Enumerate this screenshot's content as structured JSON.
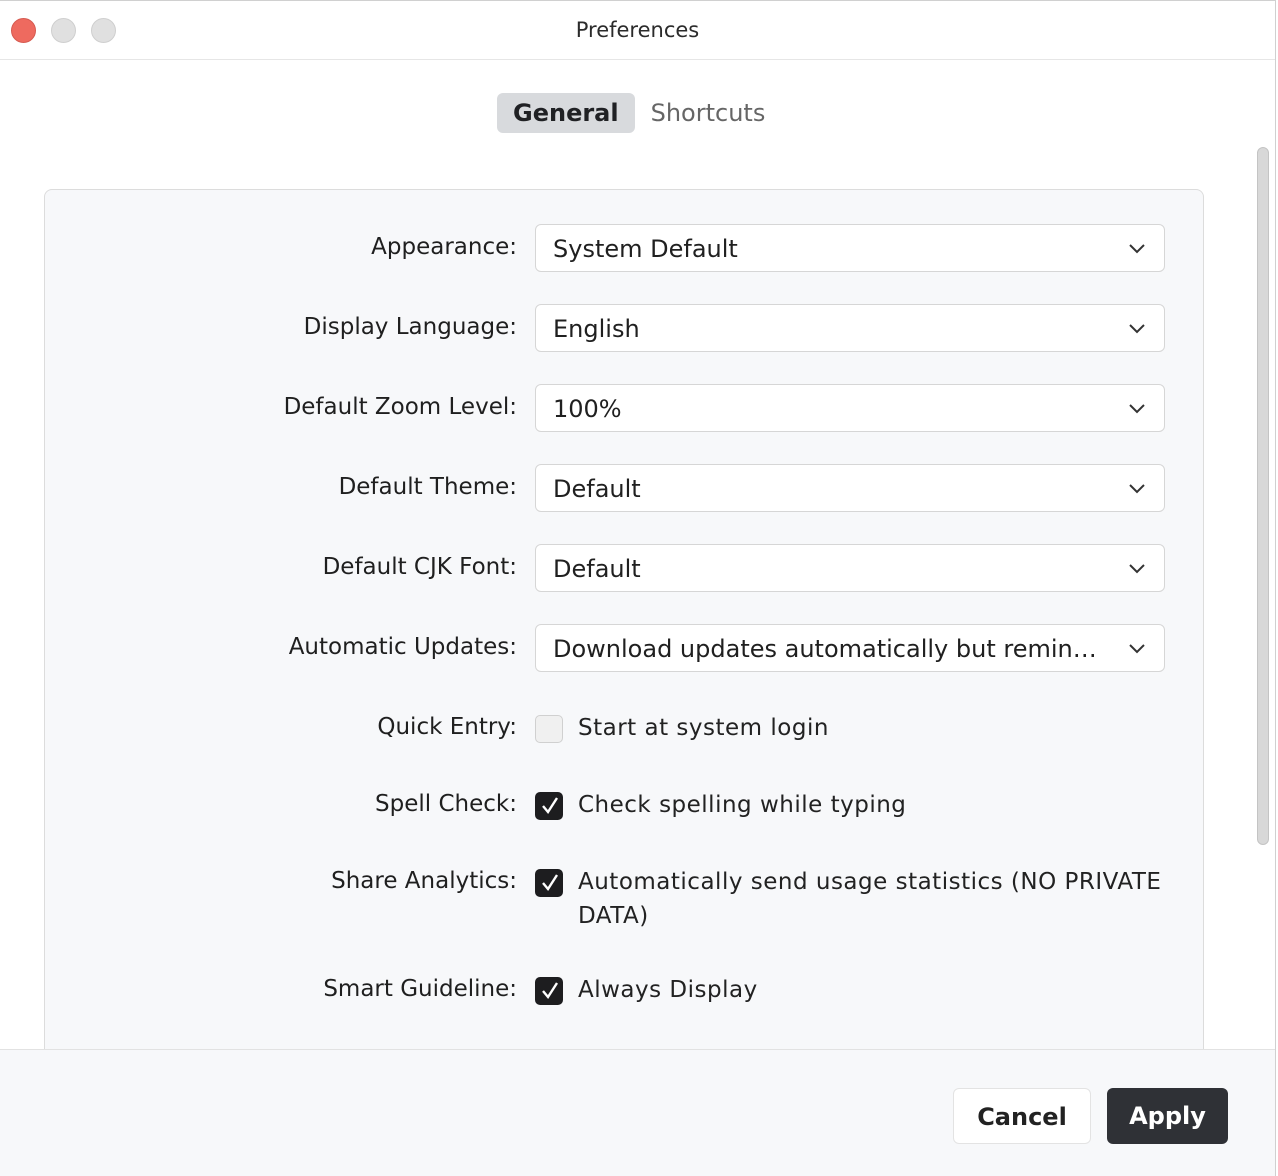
{
  "window": {
    "title": "Preferences"
  },
  "tabs": [
    {
      "label": "General",
      "active": true
    },
    {
      "label": "Shortcuts",
      "active": false
    }
  ],
  "settings": {
    "appearance": {
      "label": "Appearance:",
      "value": "System Default"
    },
    "display_language": {
      "label": "Display Language:",
      "value": "English"
    },
    "zoom_level": {
      "label": "Default Zoom Level:",
      "value": "100%"
    },
    "theme": {
      "label": "Default Theme:",
      "value": "Default"
    },
    "cjk_font": {
      "label": "Default CJK Font:",
      "value": "Default"
    },
    "updates": {
      "label": "Automatic Updates:",
      "value": "Download updates automatically but remind me before installing"
    },
    "quick_entry": {
      "label": "Quick Entry:",
      "option": "Start at system login",
      "checked": false
    },
    "spell_check": {
      "label": "Spell Check:",
      "option": "Check spelling while typing",
      "checked": true
    },
    "share_analytics": {
      "label": "Share Analytics:",
      "option": "Automatically send usage statistics (NO PRIVATE DATA)",
      "checked": true
    },
    "smart_guideline": {
      "label": "Smart Guideline:",
      "option": "Always Display",
      "checked": true
    }
  },
  "footer": {
    "cancel_label": "Cancel",
    "apply_label": "Apply"
  },
  "colors": {
    "close_button": "#ee6a5f",
    "primary_button": "#2f3136",
    "active_tab": "#d8dadd",
    "panel_background": "#f7f8fa"
  },
  "icons": {
    "dropdown": "chevron-down-icon",
    "checked": "checkmark-icon"
  }
}
